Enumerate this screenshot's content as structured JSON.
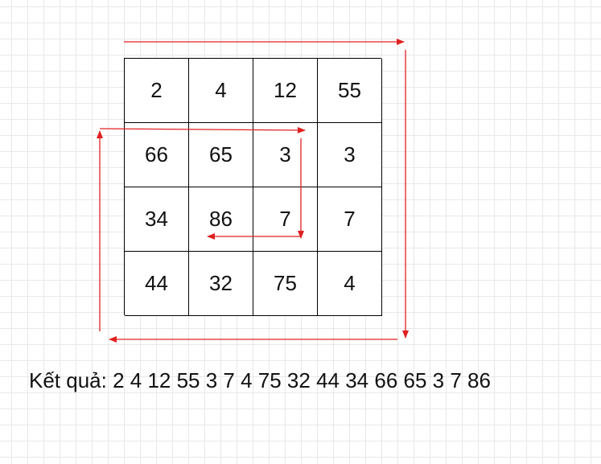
{
  "matrix": {
    "rows": [
      [
        "2",
        "4",
        "12",
        "55"
      ],
      [
        "66",
        "65",
        "3",
        "3"
      ],
      [
        "34",
        "86",
        "7",
        "7"
      ],
      [
        "44",
        "32",
        "75",
        "4"
      ]
    ]
  },
  "result": {
    "text": "Kết quả: 2 4 12 55 3 7 4 75 32 44 34 66 65 3 7 86"
  },
  "arrows": {
    "color": "#e02020"
  }
}
